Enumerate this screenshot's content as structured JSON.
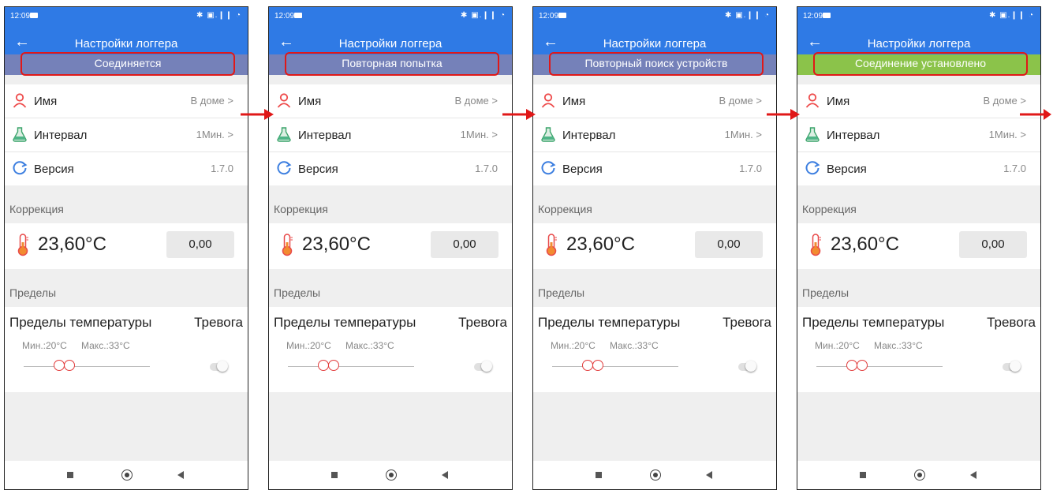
{
  "status_bar": {
    "time": "12:09",
    "system_icons": "✱ ▣.❙❙ ◔"
  },
  "app_bar": {
    "title": "Настройки логгера"
  },
  "screens": [
    {
      "banner": "Соединяется",
      "banner_color": "#7581b9"
    },
    {
      "banner": "Повторная попытка",
      "banner_color": "#7581b9"
    },
    {
      "banner": "Повторный поиск устройств",
      "banner_color": "#7581b9"
    },
    {
      "banner": "Соединение установлено",
      "banner_color": "#8bc34a"
    }
  ],
  "info": {
    "name": {
      "label": "Имя",
      "value": "В доме",
      "chevron": ">"
    },
    "interval": {
      "label": "Интервал",
      "value": "1Мин.",
      "chevron": ">"
    },
    "version": {
      "label": "Версия",
      "value": "1.7.0"
    }
  },
  "correction": {
    "title": "Коррекция",
    "temperature": "23,60°C",
    "offset": "0,00"
  },
  "limits": {
    "title": "Пределы",
    "temp_limits_label": "Пределы температуры",
    "alarm_label": "Тревога",
    "min_label": "Мин.:20°C",
    "max_label": "Макс.:33°C",
    "alarm_enabled": false
  },
  "colors": {
    "accent": "#2f7ae5",
    "highlight_border": "#e01818",
    "arrow": "#e01818"
  }
}
